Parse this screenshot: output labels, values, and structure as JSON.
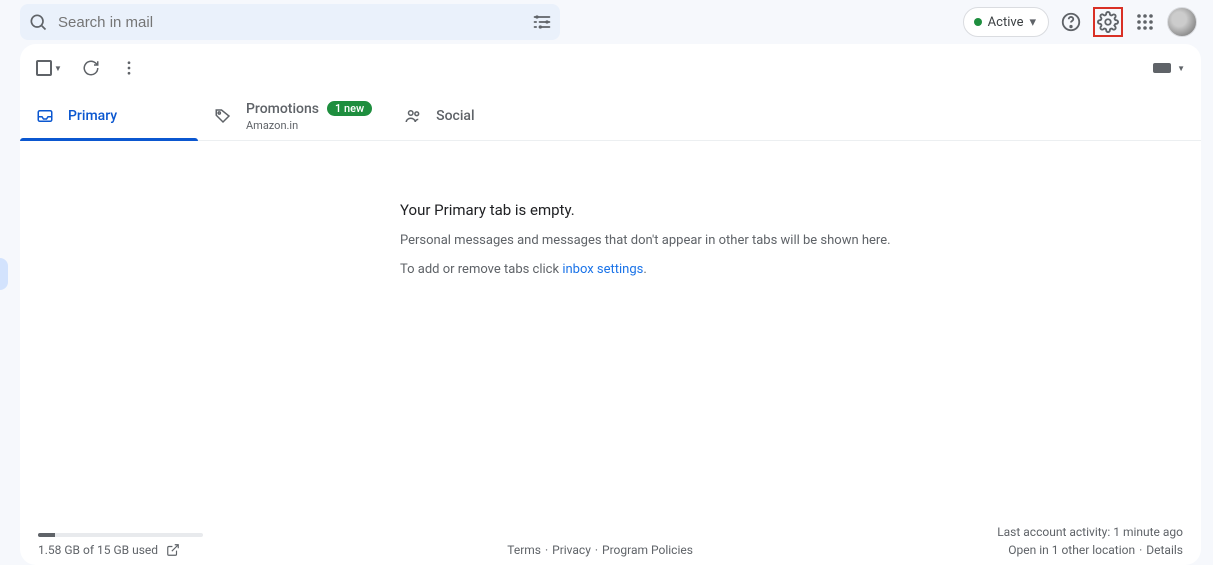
{
  "search": {
    "placeholder": "Search in mail"
  },
  "status": {
    "label": "Active"
  },
  "tabs": [
    {
      "icon": "inbox",
      "label": "Primary",
      "active": true
    },
    {
      "icon": "tag",
      "label": "Promotions",
      "badge": "1 new",
      "sub": "Amazon.in"
    },
    {
      "icon": "people",
      "label": "Social"
    }
  ],
  "empty": {
    "title": "Your Primary tab is empty.",
    "line2": "Personal messages and messages that don't appear in other tabs will be shown here.",
    "line3_prefix": "To add or remove tabs click ",
    "line3_link": "inbox settings"
  },
  "storage": {
    "text": "1.58 GB of 15 GB used",
    "percent": 10
  },
  "footer_links": {
    "terms": "Terms",
    "privacy": "Privacy",
    "policies": "Program Policies"
  },
  "activity": {
    "line1": "Last account activity: 1 minute ago",
    "line2_prefix": "Open in 1 other location",
    "details": "Details"
  }
}
